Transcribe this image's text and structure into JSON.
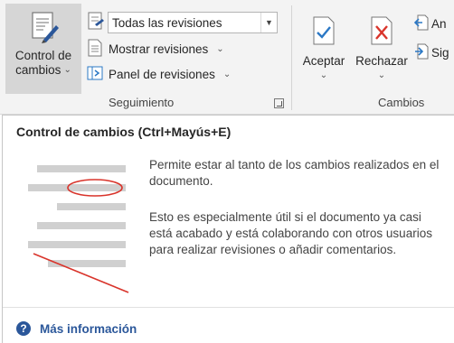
{
  "ribbon": {
    "seguimiento": {
      "control_label_1": "Control de",
      "control_label_2": "cambios",
      "combo_value": "Todas las revisiones",
      "mostrar_label": "Mostrar revisiones",
      "panel_label": "Panel de revisiones",
      "group_label": "Seguimiento"
    },
    "cambios": {
      "aceptar_label": "Aceptar",
      "rechazar_label": "Rechazar",
      "anterior_label": "An",
      "siguiente_label": "Sig",
      "group_label": "Cambios"
    }
  },
  "tooltip": {
    "title": "Control de cambios (Ctrl+Mayús+E)",
    "paragraph1": "Permite estar al tanto de los cambios realizados en el documento.",
    "paragraph2": "Esto es especialmente útil si el documento ya casi está acabado y está colaborando con otros usuarios para realizar revisiones o añadir comentarios.",
    "more_info": "Más información"
  },
  "colors": {
    "accent_blue": "#2b579a",
    "red": "#d9342b",
    "check_blue": "#2b78c5"
  }
}
